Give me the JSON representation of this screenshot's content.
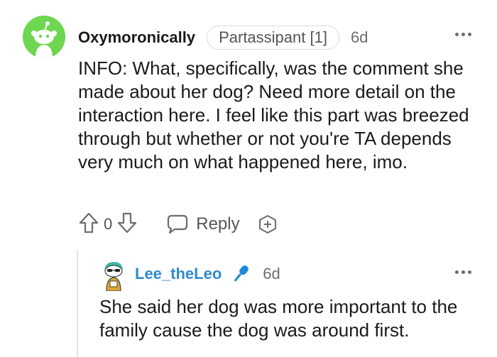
{
  "comment": {
    "username": "Oxymoronically",
    "flair": "Partassipant [1]",
    "age": "6d",
    "body": "INFO: What, specifically, was the comment she made about her dog? Need more detail on the interaction here. I feel like this part was breezed through but whether or not you're TA depends very much on what happened here, imo.",
    "vote_count": "0",
    "reply_label": "Reply",
    "avatar_color": "#6ed74f",
    "icons": [
      "more-options-icon",
      "upvote-icon",
      "downvote-icon",
      "reply-bubble-icon",
      "award-plus-icon"
    ]
  },
  "reply": {
    "username": "Lee_theLeo",
    "age": "6d",
    "body": "She said her dog was more important to the family cause the dog was around first.",
    "username_color": "#2f8ad0",
    "icons": [
      "snoo-avatar-icon",
      "microphone-icon",
      "more-options-icon"
    ]
  }
}
